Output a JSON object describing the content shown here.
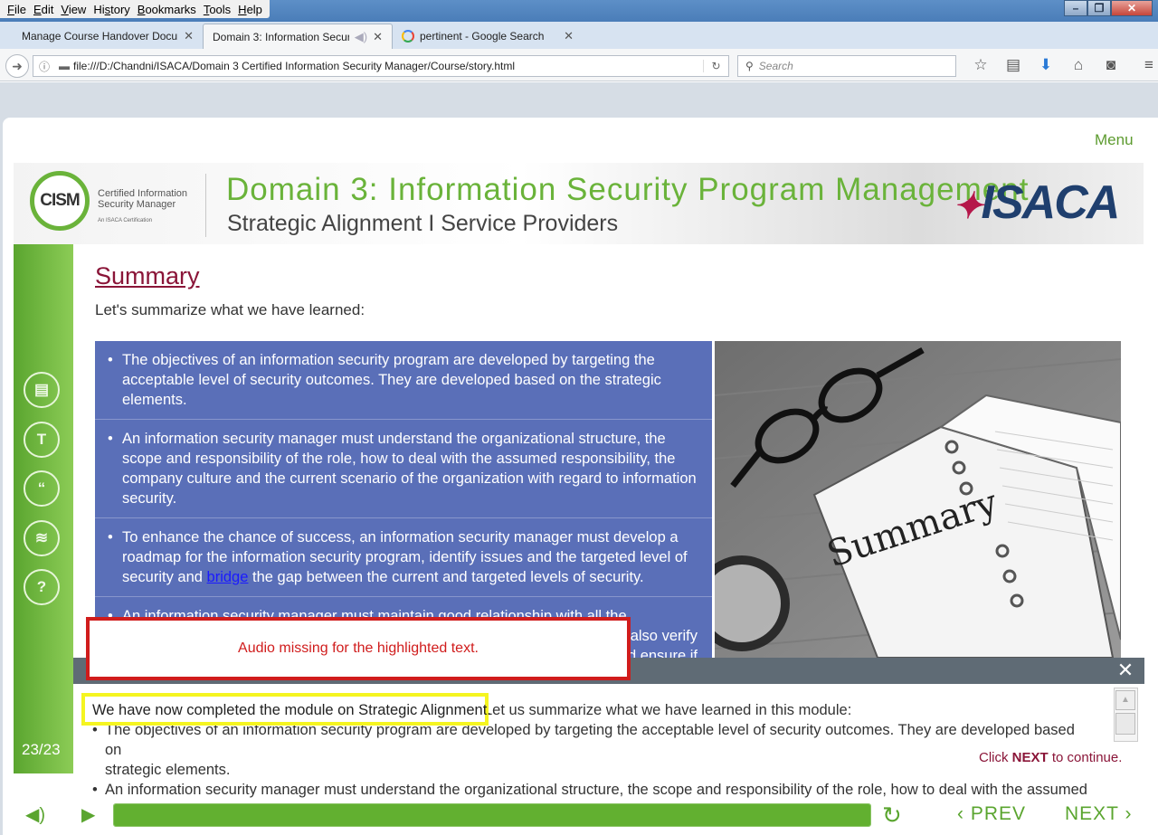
{
  "browser": {
    "menu": [
      "File",
      "Edit",
      "View",
      "History",
      "Bookmarks",
      "Tools",
      "Help"
    ],
    "tabs": [
      {
        "label": "Manage Course Handover Docum"
      },
      {
        "label": "Domain 3: Information Securi"
      },
      {
        "label": "pertinent - Google Search"
      }
    ],
    "url": "file:///D:/Chandni/ISACA/Domain 3 Certified Information Security Manager/Course/story.html",
    "search_placeholder": "Search"
  },
  "course": {
    "menu_label": "Menu",
    "cism_logo": "CISM",
    "cism_tagline": "Certified Information Security Manager",
    "cism_sub": "An ISACA Certification",
    "banner_title": "Domain 3: Information Security Program Management",
    "banner_subtitle": "Strategic Alignment I Service Providers",
    "isaca_logo": "ISACA",
    "slide_title": "Summary",
    "slide_intro": "Let's summarize what we have learned:",
    "bullets": [
      {
        "text": "The objectives of an information security program are developed by targeting the acceptable level of security outcomes. They are developed based on the strategic elements."
      },
      {
        "text": "An information security manager must understand the organizational structure, the scope and responsibility of the role, how to deal with the assumed responsibility, the company culture and the current scenario of the organization with regard to information security."
      },
      {
        "before": "To enhance the chance of success, an information security manager must develop a roadmap for the information security program, identify issues and the targeted level of security and ",
        "link": "bridge",
        "after": " the gap between the current and targeted levels of security."
      },
      {
        "text": "An information security manager must maintain good relationship with all the",
        "cont1": "also verify",
        "cont2": "nd ensure if"
      }
    ],
    "photo_label": "Summary",
    "page_counter": "23/23",
    "audio_warning": "Audio missing for the highlighted text.",
    "caption_highlight": "We have now completed the module on Strategic Alignment.",
    "caption_rest": "Let us summarize what we have learned in this module:",
    "caption_bullet1": "The objectives of an information security program are developed by targeting the acceptable level of security outcomes. They are developed based on",
    "caption_bullet1_cont": "strategic elements.",
    "caption_bullet2": "An information security manager must understand the organizational structure, the scope and responsibility of the role, how to deal with the assumed",
    "continue_prefix": "Click ",
    "continue_bold": "NEXT",
    "continue_suffix": " to continue.",
    "progress_fraction": 1.0,
    "prev_label": "PREV",
    "next_label": "NEXT"
  },
  "colors": {
    "accent_green": "#6ab33a",
    "title_maroon": "#8a1538",
    "bullet_bg": "#5a6fb8",
    "warning_red": "#d01c1c",
    "highlight_yellow": "#f5f520"
  }
}
